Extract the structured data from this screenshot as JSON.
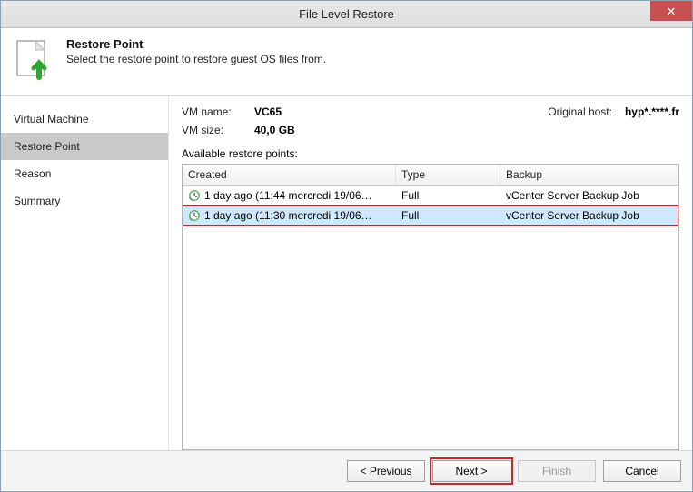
{
  "window": {
    "title": "File Level Restore",
    "close_glyph": "✕"
  },
  "header": {
    "title": "Restore Point",
    "subtitle": "Select the restore point to restore guest OS files from."
  },
  "sidebar": {
    "steps": [
      {
        "label": "Virtual Machine"
      },
      {
        "label": "Restore Point"
      },
      {
        "label": "Reason"
      },
      {
        "label": "Summary"
      }
    ],
    "active_index": 1
  },
  "main": {
    "vm_name_label": "VM name:",
    "vm_name_value": "VC65",
    "vm_size_label": "VM size:",
    "vm_size_value": "40,0 GB",
    "orig_host_label": "Original host:",
    "orig_host_value": "hyp*.****.fr",
    "available_label": "Available restore points:",
    "columns": {
      "created": "Created",
      "type": "Type",
      "backup": "Backup"
    },
    "rows": [
      {
        "created": "1 day ago (11:44 mercredi 19/06…",
        "type": "Full",
        "backup": "vCenter Server Backup Job"
      },
      {
        "created": "1 day ago (11:30 mercredi 19/06…",
        "type": "Full",
        "backup": "vCenter Server Backup Job"
      }
    ],
    "selected_index": 1
  },
  "footer": {
    "previous": "< Previous",
    "next": "Next >",
    "finish": "Finish",
    "cancel": "Cancel"
  }
}
